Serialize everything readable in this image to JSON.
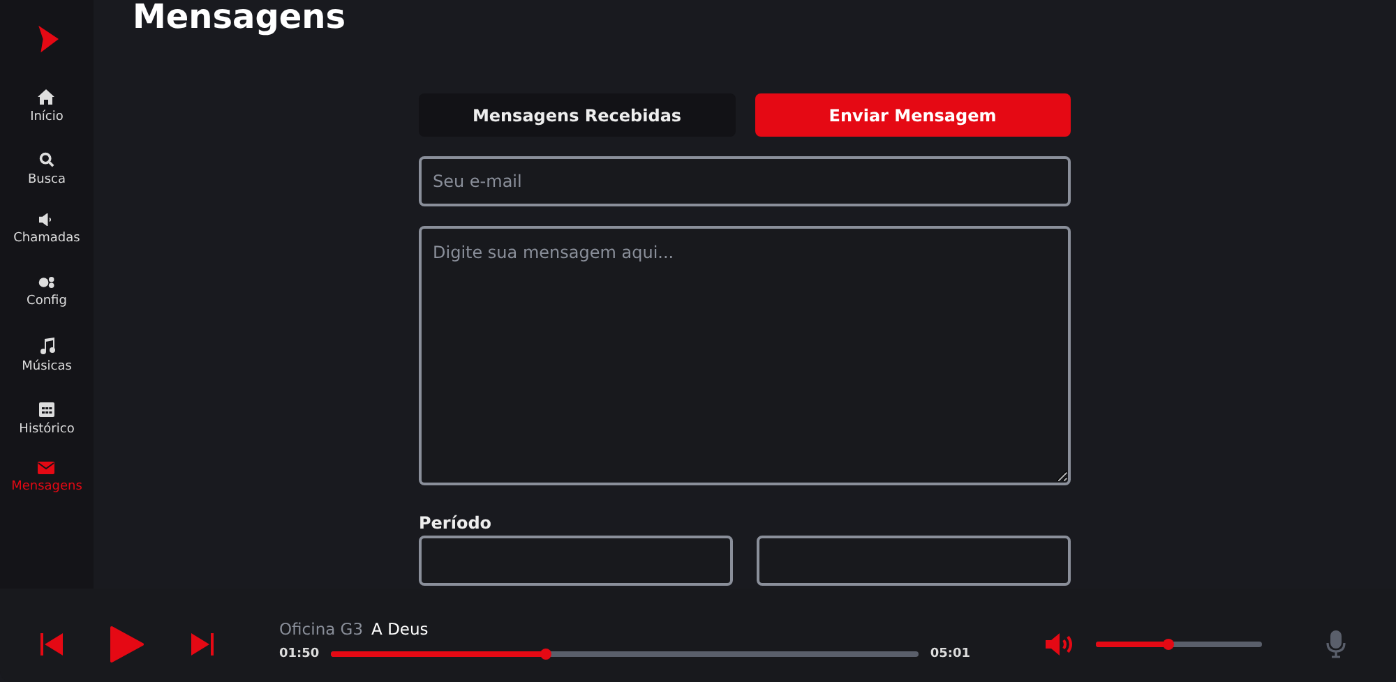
{
  "page": {
    "title": "Mensagens"
  },
  "sidebar": {
    "items": [
      {
        "label": "Início",
        "selected": false
      },
      {
        "label": "Busca",
        "selected": false
      },
      {
        "label": "Chamadas",
        "selected": false
      },
      {
        "label": "Config",
        "selected": false
      },
      {
        "label": "Músicas",
        "selected": false
      },
      {
        "label": "Histórico",
        "selected": false
      },
      {
        "label": "Mensagens",
        "selected": true
      }
    ]
  },
  "tabs": [
    {
      "label": "Mensagens Recebidas",
      "selected": false
    },
    {
      "label": "Enviar Mensagem",
      "selected": true
    }
  ],
  "form": {
    "email": {
      "placeholder": "Seu e-mail"
    },
    "message": {
      "placeholder": "Digite sua mensagem aqui..."
    },
    "period": {
      "label": "Período"
    }
  },
  "player": {
    "artist": "Oficina G3",
    "track": "A Deus",
    "elapsed": "01:50",
    "duration": "05:01",
    "progress": {
      "level": 0.365
    },
    "volume": {
      "level": 0.44
    }
  }
}
